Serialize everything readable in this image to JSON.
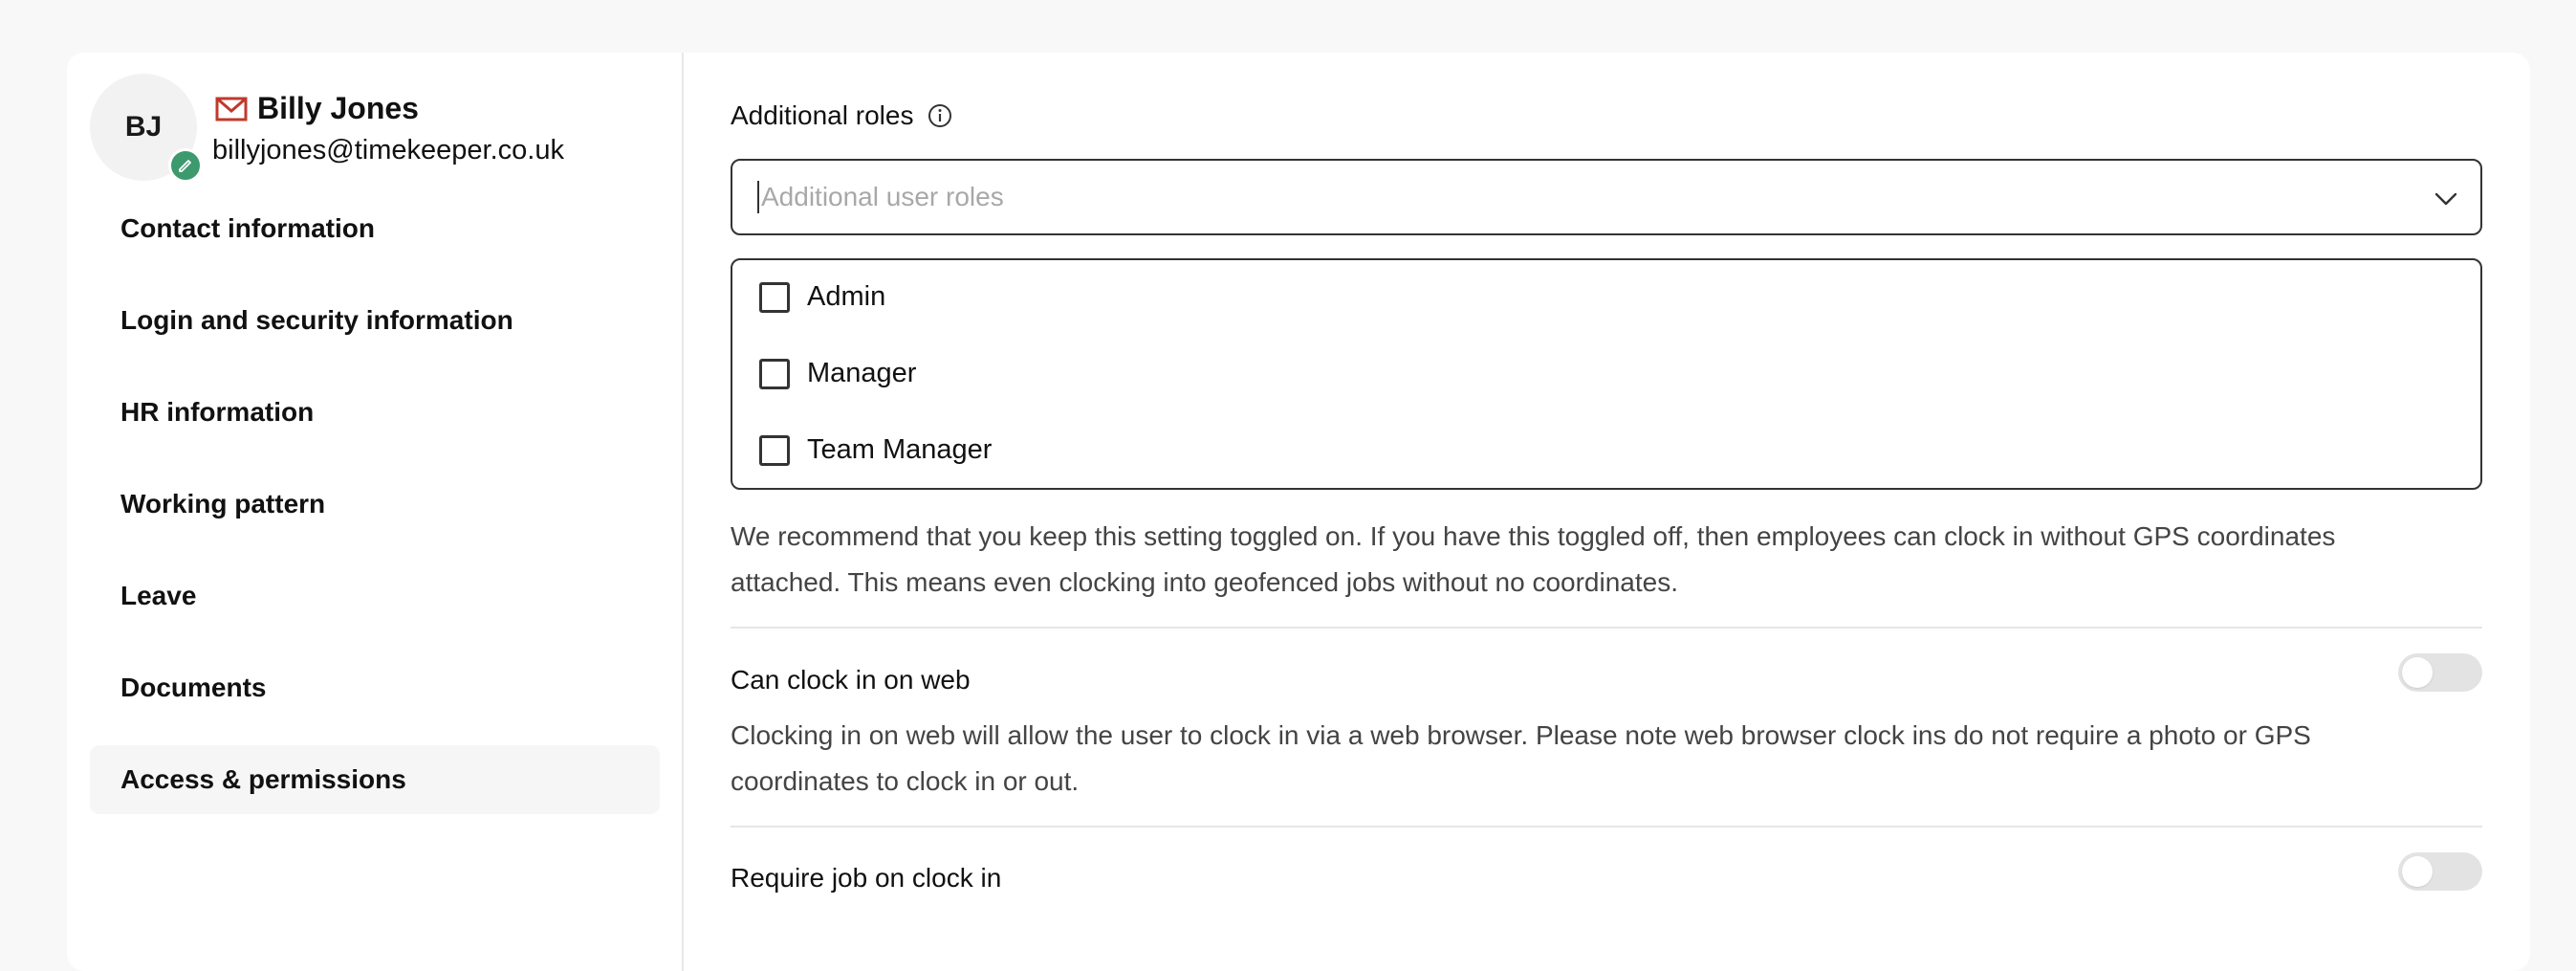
{
  "user": {
    "initials": "BJ",
    "name": "Billy Jones",
    "email": "billyjones@timekeeper.co.uk",
    "avatar_badge_color": "#3d9a6e",
    "mail_icon_color": "#c0392b"
  },
  "nav": {
    "items": [
      {
        "label": "Contact information"
      },
      {
        "label": "Login and security information"
      },
      {
        "label": "HR information"
      },
      {
        "label": "Working pattern"
      },
      {
        "label": "Leave"
      },
      {
        "label": "Documents"
      },
      {
        "label": "Access & permissions",
        "active": true
      }
    ]
  },
  "roles": {
    "label": "Additional roles",
    "placeholder": "Additional user roles",
    "options": [
      {
        "label": "Admin",
        "checked": false
      },
      {
        "label": "Manager",
        "checked": false
      },
      {
        "label": "Team Manager",
        "checked": false
      }
    ]
  },
  "settings": [
    {
      "title": "",
      "description": "We recommend that you keep this setting toggled on. If you have this toggled off, then employees can clock in without GPS coordinates attached. This means even clocking into geofenced jobs without no coordinates."
    },
    {
      "title": "Can clock in on web",
      "toggled": false,
      "description": "Clocking in on web will allow the user to clock in via a web browser. Please note web browser clock ins do not require a photo or GPS coordinates to clock in or out."
    },
    {
      "title": "Require job on clock in",
      "toggled": false
    }
  ]
}
